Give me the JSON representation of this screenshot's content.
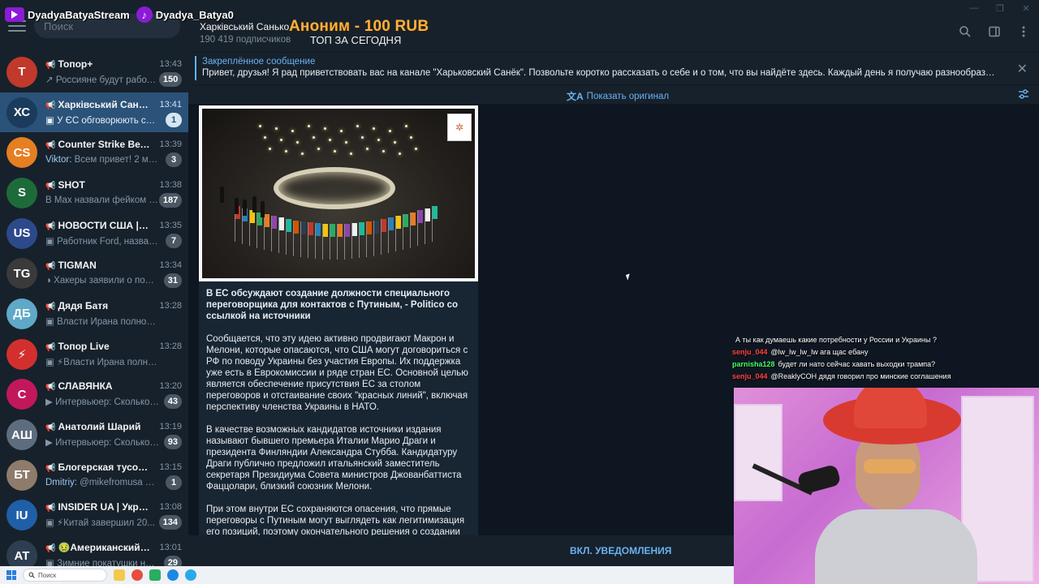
{
  "overlay": {
    "youtube_name": "DyadyaBatyaStream",
    "tiktok_name": "Dyadya_Batya0"
  },
  "sidebar": {
    "search_placeholder": "Поиск",
    "chats": [
      {
        "name": "Топор+",
        "time": "13:43",
        "sender": "",
        "preview": "Россияне будут работат...",
        "badge": "150",
        "avatar_color": "#c0392b",
        "avatar_text": "T",
        "active": false,
        "prefix": "↗"
      },
      {
        "name": "Харківський Санько",
        "time": "13:41",
        "sender": "",
        "preview": "У ЄС обговорюють створ...",
        "badge": "1",
        "avatar_color": "#1a3b5c",
        "avatar_text": "ХС",
        "active": true,
        "prefix": "▣"
      },
      {
        "name": "Counter Strike Вечера...",
        "time": "13:39",
        "sender": "Viktor:",
        "preview": "Всем привет! 2 ме...",
        "badge": "3",
        "avatar_color": "#e67e22",
        "avatar_text": "CS",
        "active": false,
        "prefix": ""
      },
      {
        "name": "SHOT",
        "time": "13:38",
        "sender": "",
        "preview": "В Max назвали фейком ин...",
        "badge": "187",
        "avatar_color": "#1e6b3a",
        "avatar_text": "S",
        "active": false,
        "prefix": ""
      },
      {
        "name": "НОВОСТИ США | АМЕ...",
        "time": "13:35",
        "sender": "",
        "preview": "Работник Ford, назвавш...",
        "badge": "7",
        "avatar_color": "#2c4a8a",
        "avatar_text": "US",
        "active": false,
        "prefix": "▣"
      },
      {
        "name": "TIGMAN",
        "time": "13:34",
        "sender": "",
        "preview": "Хакеры заявили о полн...",
        "badge": "31",
        "avatar_color": "#3a3a3a",
        "avatar_text": "TG",
        "active": false,
        "prefix": "◑"
      },
      {
        "name": "Дядя Батя",
        "time": "13:28",
        "sender": "",
        "preview": "Власти Ирана полностью ко...",
        "badge": "",
        "avatar_color": "#5fa8c8",
        "avatar_text": "ДБ",
        "active": false,
        "prefix": "▣"
      },
      {
        "name": "Топор Live",
        "time": "13:28",
        "sender": "",
        "preview": "⚡Власти Ирана полностью...",
        "badge": "",
        "avatar_color": "#d32f2f",
        "avatar_text": "⚡",
        "active": false,
        "prefix": "▣"
      },
      {
        "name": "СЛАВЯНКА",
        "time": "13:20",
        "sender": "",
        "preview": "Интервьюер:  Сколько ...",
        "badge": "43",
        "avatar_color": "#c2185b",
        "avatar_text": "С",
        "active": false,
        "prefix": "▶"
      },
      {
        "name": "Анатолий Шарий",
        "time": "13:19",
        "sender": "",
        "preview": "Интервьюер:  Сколько ...",
        "badge": "93",
        "avatar_color": "#5d6d7e",
        "avatar_text": "АШ",
        "active": false,
        "prefix": "▶"
      },
      {
        "name": "Блогерская тусовка",
        "time": "13:15",
        "sender": "Dmitriy:",
        "preview": "@mikefromusa  он п...",
        "badge": "1",
        "avatar_color": "#8e7b6b",
        "avatar_text": "БТ",
        "active": false,
        "prefix": ""
      },
      {
        "name": "INSIDER UA | Україна ...",
        "time": "13:08",
        "sender": "",
        "preview": "⚡Китай завершил 20...",
        "badge": "134",
        "avatar_color": "#1f5fa8",
        "avatar_text": "IU",
        "active": false,
        "prefix": "▣"
      },
      {
        "name": "🤢Американский тре...",
        "time": "13:01",
        "sender": "",
        "preview": "Зимние покатушки на А...",
        "badge": "29",
        "avatar_color": "#2c3e50",
        "avatar_text": "AT",
        "active": false,
        "prefix": "▣"
      }
    ]
  },
  "header": {
    "channel_title": "Харківський Санько",
    "subscribers": "190 419 подписчиков",
    "donation": "Аноним - 100 RUB",
    "top_today": "ТОП ЗА СЕГОДНЯ"
  },
  "pinned": {
    "title": "Закреплённое сообщение",
    "text": "Привет, друзья!  Я рад приветствовать вас на канале \"Харьковский Санёк\". Позвольте коротко рассказать о себе и о том, что вы найдёте здесь.  Каждый день я получаю разнообразную инфор..."
  },
  "translate": {
    "show_original": "Показать оригинал"
  },
  "post": {
    "headline": "В ЕС обсуждают создание должности специального переговорщика для контактов с Путиным, - Politico со ссылкой на источники",
    "p1": "Сообщается, что эту идею активно продвигают Макрон и Мелони, которые опасаются, что США могут договориться с РФ по поводу Украины без участия Европы. Их поддержка уже есть в Еврокомиссии и ряде стран ЕС. Основной целью является обеспечение присутствия ЕС за столом переговоров и отстаивание своих \"красных линий\", включая перспективу членства Украины в НАТО.",
    "p2": "В качестве возможных кандидатов источники издания называют бывшего премьера Италии Марио Драги и президента Финляндии Александра Стубба. Кандидатуру Драги публично предложил итальянский заместитель секретаря Президиума Совета министров Джованбаттиста Фаццолари, близкий союзник Мелони.",
    "p3": "При этом внутри ЕС сохраняются опасения, что прямые переговоры с Путиным могут выглядеть как легитимизация его позиций, поэтому окончательного решения о создании такой"
  },
  "bottom": {
    "notify_button": "ВКЛ. УВЕДОМЛЕНИЯ"
  },
  "stream_chat": [
    {
      "user": "",
      "color": "#3a6ee8",
      "text": "А ты как думаешь какие потребности у России и Украины ?"
    },
    {
      "user": "senju_044",
      "color": "#ff4444",
      "text": "@lw_lw_lw_lw ага щас ебану"
    },
    {
      "user": "parnisha128",
      "color": "#44ff66",
      "text": "будет ли нато сейчас хавать выходки трампа?"
    },
    {
      "user": "senju_044",
      "color": "#ff4444",
      "text": "@ReaklyCOH дядя говорил про минские соглашения"
    }
  ],
  "taskbar": {
    "search_placeholder": "Поиск"
  },
  "colors": {
    "sidebar_bg": "#17212b",
    "chat_bg": "#0e1621",
    "accent": "#6ab2f2",
    "active_chat": "#2b5278",
    "donation": "#ffb13d"
  }
}
